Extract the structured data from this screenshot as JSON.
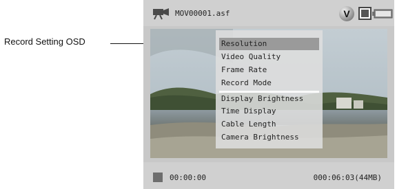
{
  "callout": {
    "label": "Record Setting OSD"
  },
  "status_bar": {
    "camera_icon": "video-camera-icon",
    "filename": "MOV00001.asf",
    "mode_badge": "V",
    "screen_icon": "display-mode-icon",
    "battery_icon": "battery-icon"
  },
  "osd_menu": {
    "items": [
      "Resolution",
      "Video Quality",
      "Frame Rate",
      "Record Mode",
      "Display Brightness",
      "Time Display",
      "Cable Length",
      "Camera Brightness"
    ],
    "selected": "Resolution"
  },
  "bottom_bar": {
    "stop_icon": "stop-icon",
    "elapsed_time": "00:00:00",
    "remaining_time": "000:06:03(44MB)"
  }
}
